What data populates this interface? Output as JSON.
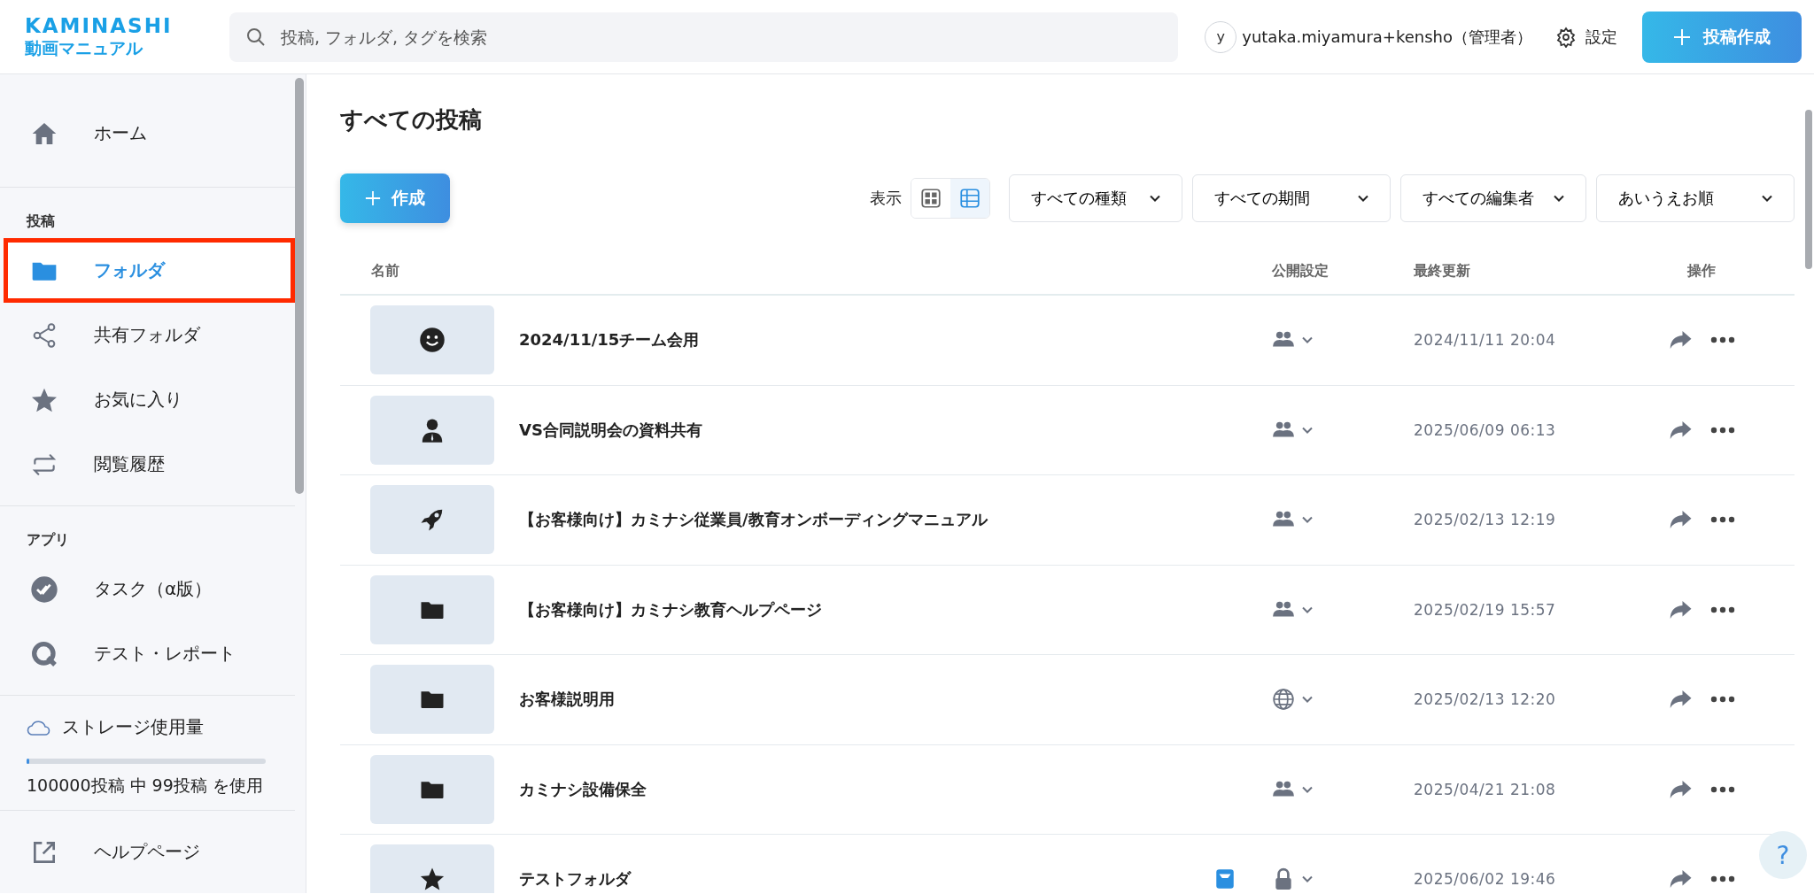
{
  "app": {
    "logo": "KAMINASHI",
    "subtitle": "動画マニュアル"
  },
  "search": {
    "placeholder": "投稿, フォルダ, タグを検索"
  },
  "user": {
    "avatar": "y",
    "name": "yutaka.miyamura+kensho（管理者）"
  },
  "settings": "設定",
  "new_post": "投稿作成",
  "sidebar": {
    "sections": [
      {
        "items": [
          {
            "kind": "home",
            "label": "ホーム",
            "selected": false,
            "highlighted": false
          }
        ]
      },
      {
        "heading": "投稿",
        "items": [
          {
            "kind": "folder",
            "label": "フォルダ",
            "selected": true,
            "highlighted": true
          },
          {
            "kind": "share",
            "label": "共有フォルダ",
            "selected": false,
            "highlighted": false
          },
          {
            "kind": "star",
            "label": "お気に入り",
            "selected": false,
            "highlighted": false
          },
          {
            "kind": "history",
            "label": "閲覧履歴",
            "selected": false,
            "highlighted": false
          }
        ]
      },
      {
        "heading": "アプリ",
        "items": [
          {
            "kind": "task",
            "label": "タスク（α版）",
            "selected": false,
            "highlighted": false
          },
          {
            "kind": "test",
            "label": "テスト・レポート",
            "selected": false,
            "highlighted": false
          }
        ]
      }
    ],
    "storage": {
      "label": "ストレージ使用量",
      "level": 0.01,
      "usage": "100000投稿 中 99投稿 を使用"
    },
    "help": {
      "kind": "help",
      "label": "ヘルプページ"
    }
  },
  "page_title": "すべての投稿",
  "create": "作成",
  "view_label": "表示",
  "view_modes": [
    {
      "kind": "grid",
      "selected": false
    },
    {
      "kind": "list",
      "selected": true
    }
  ],
  "filters": [
    "すべての種類",
    "すべての期間",
    "すべての編集者",
    "あいうえお順"
  ],
  "table": {
    "columns": [
      "名前",
      "公開設定",
      "最終更新",
      "操作"
    ],
    "rows": [
      {
        "thumb": {
          "kind": "smile"
        },
        "name": "2024/11/15チーム会用",
        "visibility": {
          "kind": "group"
        },
        "updated": "2024/11/11 20:04",
        "pinned": false
      },
      {
        "thumb": {
          "kind": "person"
        },
        "name": "VS合同説明会の資料共有",
        "visibility": {
          "kind": "group"
        },
        "updated": "2025/06/09 06:13",
        "pinned": false
      },
      {
        "thumb": {
          "kind": "rocket"
        },
        "name": "【お客様向け】カミナシ従業員/教育オンボーディングマニュアル",
        "visibility": {
          "kind": "group"
        },
        "updated": "2025/02/13 12:19",
        "pinned": false
      },
      {
        "thumb": {
          "kind": "folder"
        },
        "name": "【お客様向け】カミナシ教育ヘルプページ",
        "visibility": {
          "kind": "group"
        },
        "updated": "2025/02/19 15:57",
        "pinned": false
      },
      {
        "thumb": {
          "kind": "folder"
        },
        "name": "お客様説明用",
        "visibility": {
          "kind": "globe"
        },
        "updated": "2025/02/13 12:20",
        "pinned": false
      },
      {
        "thumb": {
          "kind": "folder"
        },
        "name": "カミナシ設備保全",
        "visibility": {
          "kind": "group"
        },
        "updated": "2025/04/21 21:08",
        "pinned": false
      },
      {
        "thumb": {
          "kind": "star"
        },
        "name": "テストフォルダ",
        "visibility": {
          "kind": "lock"
        },
        "updated": "2025/06/02 19:46",
        "pinned": true
      }
    ]
  },
  "help_button": "?"
}
